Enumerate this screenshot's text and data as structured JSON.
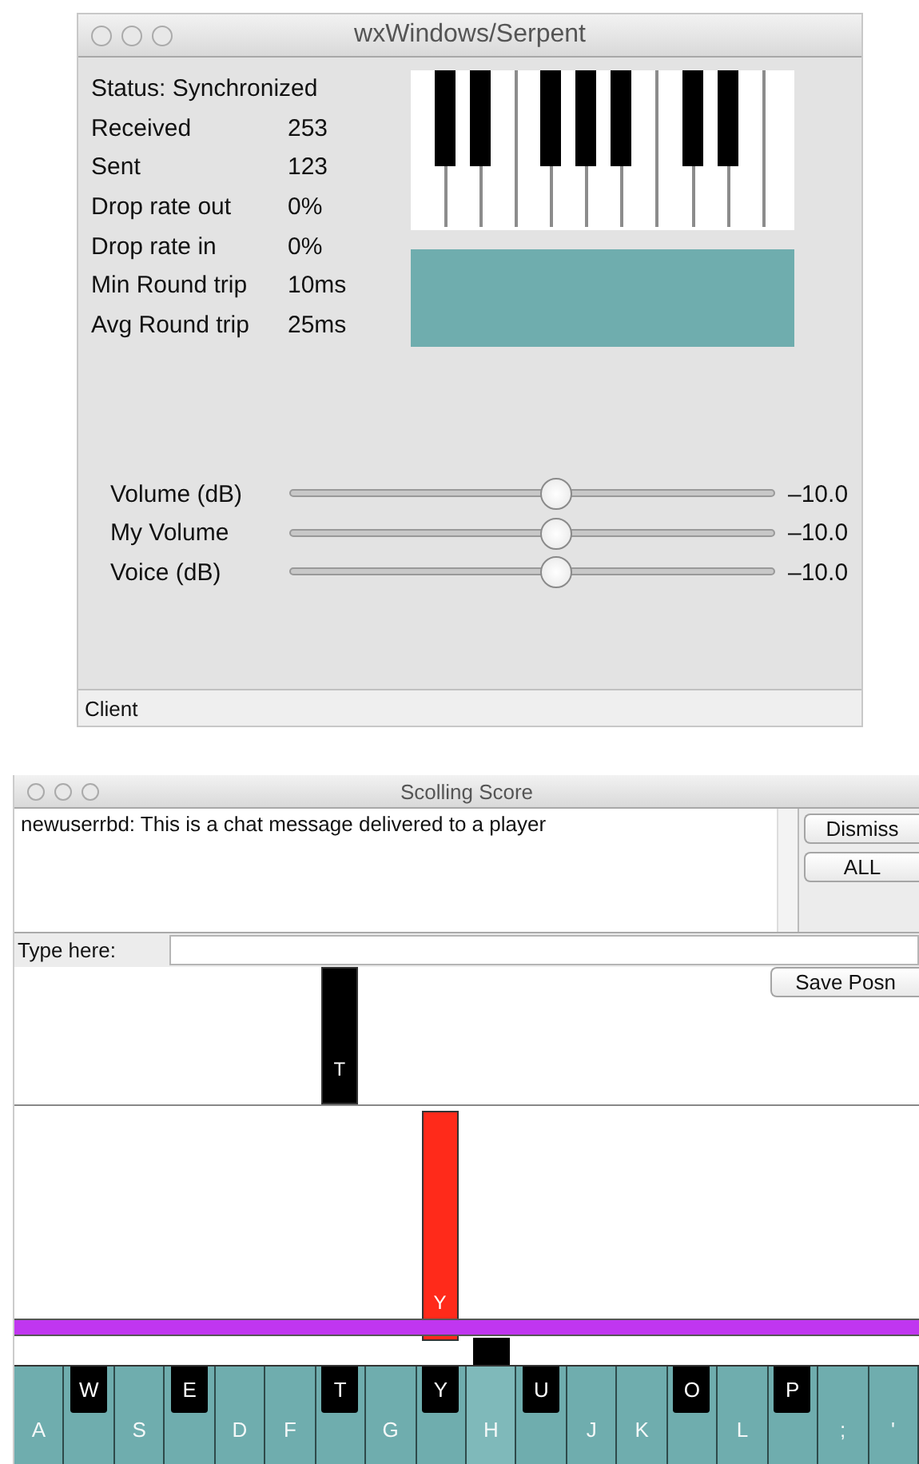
{
  "top_window": {
    "title": "wxWindows/Serpent",
    "status": "Status: Synchronized",
    "stats": [
      {
        "label": "Received",
        "value": "253"
      },
      {
        "label": "Sent",
        "value": "123"
      },
      {
        "label": "Drop rate out",
        "value": "0%"
      },
      {
        "label": "Drop rate in",
        "value": "0%"
      },
      {
        "label": "Min Round trip",
        "value": "10ms"
      },
      {
        "label": "Avg Round trip",
        "value": "25ms"
      }
    ],
    "sliders": [
      {
        "label": "Volume (dB)",
        "level": 0.55,
        "reading": "–10.0"
      },
      {
        "label": "My Volume",
        "level": 0.55,
        "reading": "–10.0"
      },
      {
        "label": "Voice (dB)",
        "level": 0.55,
        "reading": "–10.0"
      }
    ],
    "status_bar": "Client"
  },
  "bottom_window": {
    "title": "Scolling Score",
    "chat_messages": [
      "newuserrbd: This is a chat message delivered to a player"
    ],
    "chat_buttons": [
      "Dismiss",
      "ALL"
    ],
    "input_label": "Type here:",
    "save_button": "Save Posn",
    "keys": [
      {
        "label": "A",
        "kind": "white",
        "selected": false
      },
      {
        "label": "W",
        "kind": "black",
        "selected": false
      },
      {
        "label": "S",
        "kind": "white",
        "selected": false
      },
      {
        "label": "E",
        "kind": "black",
        "selected": false
      },
      {
        "label": "D",
        "kind": "white",
        "selected": false
      },
      {
        "label": "F",
        "kind": "white",
        "selected": false
      },
      {
        "label": "T",
        "kind": "black",
        "selected": false,
        "note": {
          "label": "T",
          "kind": "upper",
          "color": "#000000"
        }
      },
      {
        "label": "G",
        "kind": "white",
        "selected": false
      },
      {
        "label": "Y",
        "kind": "black",
        "selected": false,
        "note": {
          "label": "Y",
          "kind": "lower",
          "color": "#ff2a1a"
        }
      },
      {
        "label": "H",
        "kind": "white",
        "selected": true
      },
      {
        "label": "U",
        "kind": "black",
        "selected": false
      },
      {
        "label": "J",
        "kind": "white",
        "selected": false
      },
      {
        "label": "K",
        "kind": "white",
        "selected": false
      },
      {
        "label": "O",
        "kind": "black",
        "selected": false
      },
      {
        "label": "L",
        "kind": "white",
        "selected": false
      },
      {
        "label": "P",
        "kind": "black",
        "selected": false
      },
      {
        "label": ";",
        "kind": "white",
        "selected": false
      },
      {
        "label": "'",
        "kind": "white",
        "selected": false
      }
    ]
  }
}
